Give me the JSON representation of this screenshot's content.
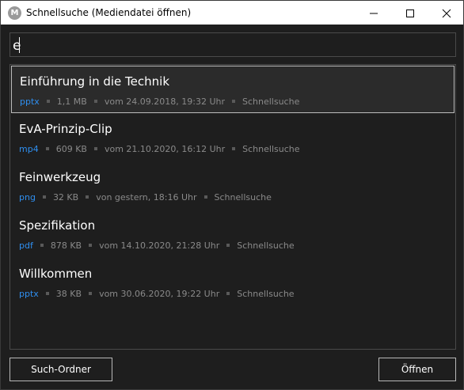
{
  "window": {
    "title": "Schnellsuche (Mediendatei öffnen)",
    "icon_letter": "M",
    "icons": [
      "app-logo-icon",
      "minimize-icon",
      "maximize-icon",
      "close-icon"
    ]
  },
  "search": {
    "value": "e"
  },
  "results": [
    {
      "title": "Einführung in die Technik",
      "ext": "pptx",
      "size": "1,1 MB",
      "date": "vom 24.09.2018, 19:32 Uhr",
      "source": "Schnellsuche",
      "selected": true
    },
    {
      "title": "EvA-Prinzip-Clip",
      "ext": "mp4",
      "size": "609 KB",
      "date": "vom 21.10.2020, 16:12 Uhr",
      "source": "Schnellsuche",
      "selected": false
    },
    {
      "title": "Feinwerkzeug",
      "ext": "png",
      "size": "32 KB",
      "date": "von gestern, 18:16 Uhr",
      "source": "Schnellsuche",
      "selected": false
    },
    {
      "title": "Spezifikation",
      "ext": "pdf",
      "size": "878 KB",
      "date": "vom 14.10.2020, 21:28 Uhr",
      "source": "Schnellsuche",
      "selected": false
    },
    {
      "title": "Willkommen",
      "ext": "pptx",
      "size": "38 KB",
      "date": "vom 30.06.2020, 19:22 Uhr",
      "source": "Schnellsuche",
      "selected": false
    }
  ],
  "buttons": {
    "search_folder": "Such-Ordner",
    "open": "Öffnen"
  },
  "colors": {
    "background": "#1e1e1e",
    "text": "#ffffff",
    "meta_text": "#8a8a8a",
    "extension_accent": "#2f8ff0",
    "selection_border": "#bdbdbd"
  }
}
